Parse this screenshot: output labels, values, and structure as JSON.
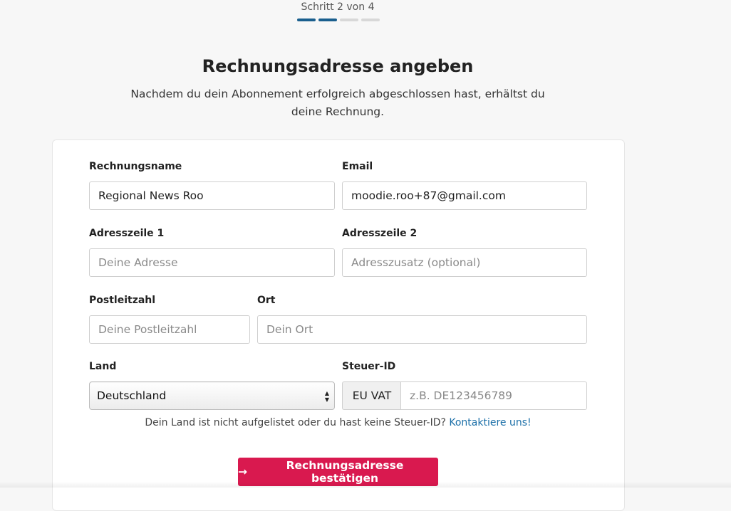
{
  "stepper": {
    "text": "Schritt 2 von 4",
    "segments": [
      true,
      true,
      false,
      false
    ]
  },
  "header": {
    "title": "Rechnungsadresse angeben",
    "subtitle": "Nachdem du dein Abonnement erfolgreich abgeschlossen hast, erhältst du deine Rechnung."
  },
  "form": {
    "billing_name": {
      "label": "Rechnungsname",
      "value": "Regional News Roo"
    },
    "email": {
      "label": "Email",
      "value": "moodie.roo+87@gmail.com"
    },
    "address1": {
      "label": "Adresszeile 1",
      "placeholder": "Deine Adresse"
    },
    "address2": {
      "label": "Adresszeile 2",
      "placeholder": "Adresszusatz (optional)"
    },
    "postal_code": {
      "label": "Postleitzahl",
      "placeholder": "Deine Postleitzahl"
    },
    "city": {
      "label": "Ort",
      "placeholder": "Dein Ort"
    },
    "country": {
      "label": "Land",
      "value": "Deutschland"
    },
    "tax_id": {
      "label": "Steuer-ID",
      "prefix": "EU VAT",
      "placeholder": "z.B. DE123456789"
    },
    "help_text": "Dein Land ist nicht aufgelistet oder du hast keine Steuer-ID?",
    "help_link": "Kontaktiere uns!",
    "submit_label": "Rechnungsadresse bestätigen"
  },
  "colors": {
    "accent": "#d9194f",
    "progress_active": "#1a5f8e",
    "progress_inactive": "#d8d8d8",
    "link": "#1b6fa8"
  }
}
